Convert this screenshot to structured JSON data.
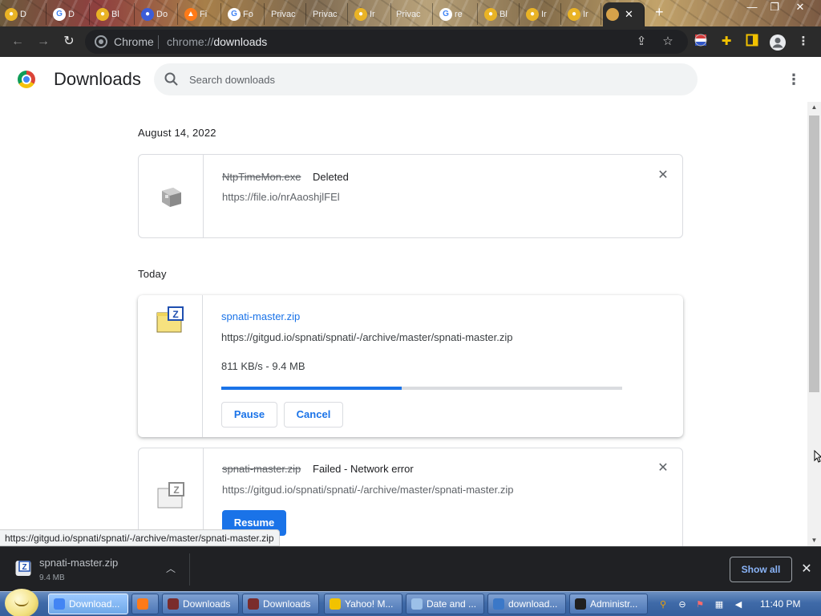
{
  "browser": {
    "tabs": [
      {
        "label": "D"
      },
      {
        "label": "Bl"
      },
      {
        "label": "Do"
      },
      {
        "label": "Fi"
      },
      {
        "label": "Fo"
      },
      {
        "label": "Privac"
      },
      {
        "label": "Privac"
      },
      {
        "label": "Ir"
      },
      {
        "label": "Privac"
      },
      {
        "label": "re"
      },
      {
        "label": "Bl"
      },
      {
        "label": "Ir"
      },
      {
        "label": "Ir"
      }
    ],
    "active_tab_close": "✕",
    "new_tab": "+",
    "omnibox": {
      "chip": "Chrome",
      "url_scheme": "chrome://",
      "url_path": "downloads"
    }
  },
  "page": {
    "title": "Downloads",
    "search_placeholder": "Search downloads",
    "groups": [
      {
        "date": "August 14, 2022",
        "items": [
          {
            "filename": "NtpTimeMon.exe",
            "status": "Deleted",
            "url": "https://file.io/nrAaoshjlFEl"
          }
        ]
      },
      {
        "date": "Today",
        "items": [
          {
            "filename": "spnati-master.zip",
            "url": "https://gitgud.io/spnati/spnati/-/archive/master/spnati-master.zip",
            "progress_text": "811 KB/s - 9.4 MB",
            "progress_fraction": 0.45,
            "pause_label": "Pause",
            "cancel_label": "Cancel"
          },
          {
            "filename": "spnati-master.zip",
            "status": "Failed - Network error",
            "url": "https://gitgud.io/spnati/spnati/-/archive/master/spnati-master.zip",
            "resume_label": "Resume"
          }
        ]
      }
    ],
    "status_bubble": "https://gitgud.io/spnati/spnati/-/archive/master/spnati-master.zip"
  },
  "shelf": {
    "filename": "spnati-master.zip",
    "size": "9.4 MB",
    "show_all": "Show all"
  },
  "taskbar": {
    "tasks": [
      {
        "label": "Download...",
        "color": "#4285f4"
      },
      {
        "label": "",
        "color": "#ff7a18"
      },
      {
        "label": "Downloads",
        "color": "#7a2c2c"
      },
      {
        "label": "Downloads",
        "color": "#7a2c2c"
      },
      {
        "label": "Yahoo! M...",
        "color": "#f2c200"
      },
      {
        "label": "Date and ...",
        "color": "#9cc0e8"
      },
      {
        "label": "download...",
        "color": "#3b78c8"
      },
      {
        "label": "Administr...",
        "color": "#202020"
      }
    ],
    "clock": "11:40 PM"
  },
  "colors": {
    "accent": "#1a73e8",
    "progress_track": "#dadce0",
    "shelf_bg": "#202124"
  }
}
